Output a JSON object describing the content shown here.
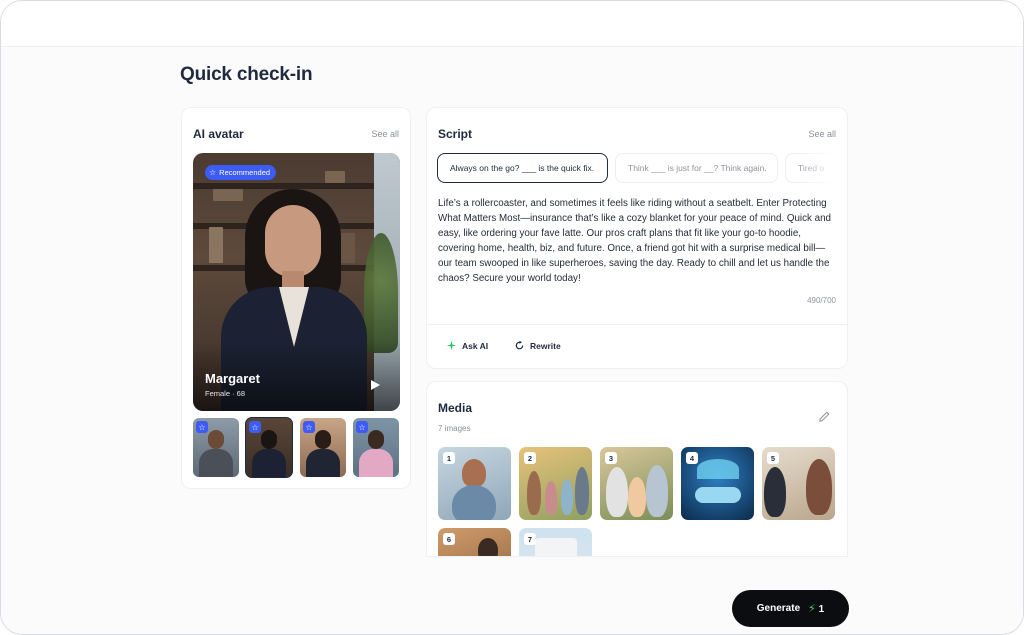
{
  "page": {
    "title": "Quick check-in"
  },
  "avatar_card": {
    "title": "AI avatar",
    "see_all": "See all",
    "featured": {
      "badge": "Recommended",
      "name": "Margaret",
      "meta": "Female · 68"
    },
    "thumbnails": [
      {
        "name": "avatar-option-1",
        "selected": false
      },
      {
        "name": "avatar-option-2",
        "selected": true
      },
      {
        "name": "avatar-option-3",
        "selected": false
      },
      {
        "name": "avatar-option-4",
        "selected": false
      }
    ]
  },
  "script_card": {
    "title": "Script",
    "see_all": "See all",
    "chips": [
      {
        "label": "Always on the go? ___ is the quick fix.",
        "active": true
      },
      {
        "label": "Think ___ is just for __? Think again.",
        "active": false
      },
      {
        "label": "Tired o",
        "active": false
      }
    ],
    "text": "Life’s a rollercoaster, and sometimes it feels like riding without a seatbelt. Enter Protecting What Matters Most—insurance that’s like a cozy blanket for your peace of mind. Quick and easy, like ordering your fave latte. Our pros craft plans that fit like your go-to hoodie, covering home, health, biz, and future. Once, a friend got hit with a surprise medical bill—our team swooped in like superheroes, saving the day. Ready to chill and let us handle the chaos? Secure your world today!",
    "counter": "490/700",
    "actions": {
      "ask_ai": "Ask AI",
      "rewrite": "Rewrite"
    }
  },
  "media_card": {
    "title": "Media",
    "count": "7 images",
    "items": [
      "1",
      "2",
      "3",
      "4",
      "5",
      "6",
      "7"
    ]
  },
  "generate": {
    "label": "Generate",
    "credits": "1"
  },
  "colors": {
    "accent": "#3d5bf5",
    "dark": "#0c0d10",
    "bolt": "#46d36b"
  }
}
